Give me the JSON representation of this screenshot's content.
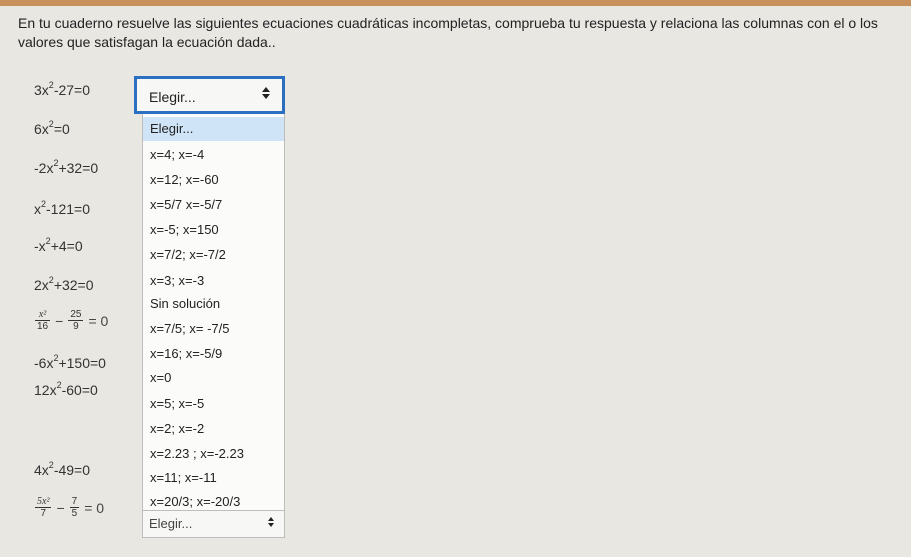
{
  "instructions": "En tu cuaderno resuelve las siguientes ecuaciones cuadráticas incompletas, comprueba tu respuesta y relaciona las columnas con el o los valores que satisfagan la ecuación dada..",
  "equations": [
    {
      "a": "3x",
      "b": "2",
      "c": "-27=0"
    },
    {
      "a": "6x",
      "b": "2",
      "c": "=0"
    },
    {
      "a": "-2x",
      "b": "2",
      "c": "+32=0"
    },
    {
      "a": "x",
      "b": "2",
      "c": "-121=0"
    },
    {
      "a": "-x",
      "b": "2",
      "c": "+4=0"
    },
    {
      "a": "2x",
      "b": "2",
      "c": "+32=0"
    },
    {
      "n1": "x²",
      "d1": "16",
      "op": "−",
      "n2": "25",
      "d2": "9",
      "rhs": "= 0"
    },
    {
      "a": "-6x",
      "b": "2",
      "c": "+150=0"
    },
    {
      "a": "12x",
      "b": "2",
      "c": "-60=0"
    },
    {
      "a": "4x",
      "b": "2",
      "c": "-49=0"
    },
    {
      "n1": "5x²",
      "d1": "7",
      "op": "−",
      "n2": "7",
      "d2": "5",
      "rhs": "= 0"
    }
  ],
  "select_open": {
    "value": "Elegir...",
    "options": [
      "Elegir...",
      "x=4; x=-4",
      "x=12; x=-60",
      "x=5/7 x=-5/7",
      "x=-5; x=150",
      "x=7/2; x=-7/2",
      "x=3; x=-3",
      "Sin solución",
      "x=7/5; x= -7/5",
      "x=16; x=-5/9",
      "x=0",
      "x=5; x=-5",
      "x=2; x=-2",
      "x=2.23 ; x=-2.23",
      "x=11; x=-11",
      "x=20/3; x=-20/3"
    ]
  },
  "select_last": {
    "value": "Elegir..."
  }
}
